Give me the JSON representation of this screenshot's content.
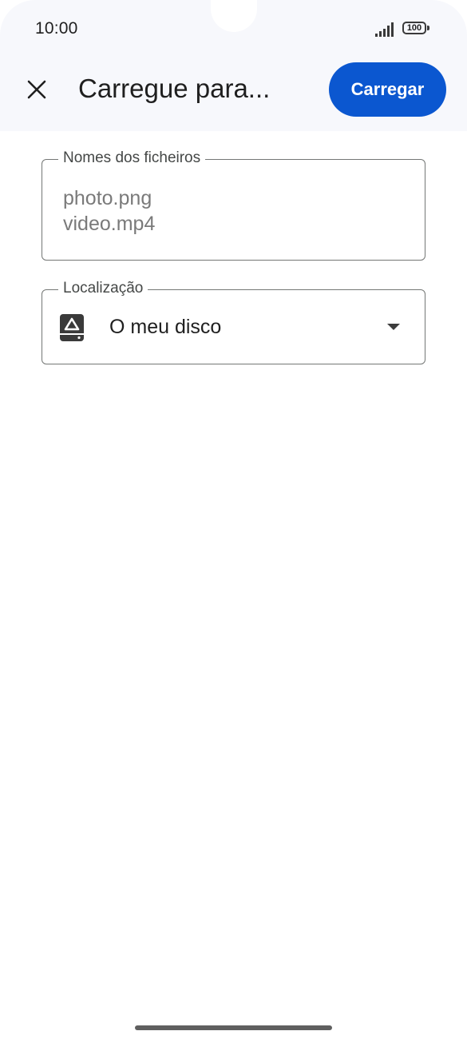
{
  "status_bar": {
    "time": "10:00",
    "battery": "100",
    "signal_icon": "signal-bars-icon",
    "battery_icon": "battery-icon"
  },
  "app_bar": {
    "close_icon": "close-icon",
    "title": "Carregue para...",
    "upload_label": "Carregar"
  },
  "filenames_field": {
    "label": "Nomes dos ficheiros",
    "files": [
      "photo.png",
      "video.mp4"
    ]
  },
  "location_field": {
    "label": "Localização",
    "icon": "drive-icon",
    "value": "O meu disco",
    "dropdown_icon": "dropdown-arrow-icon"
  },
  "colors": {
    "accent": "#0b57d0",
    "header_bg": "#f7f8fc",
    "text": "#1f1f1f",
    "placeholder_text": "#7a7a7a"
  }
}
